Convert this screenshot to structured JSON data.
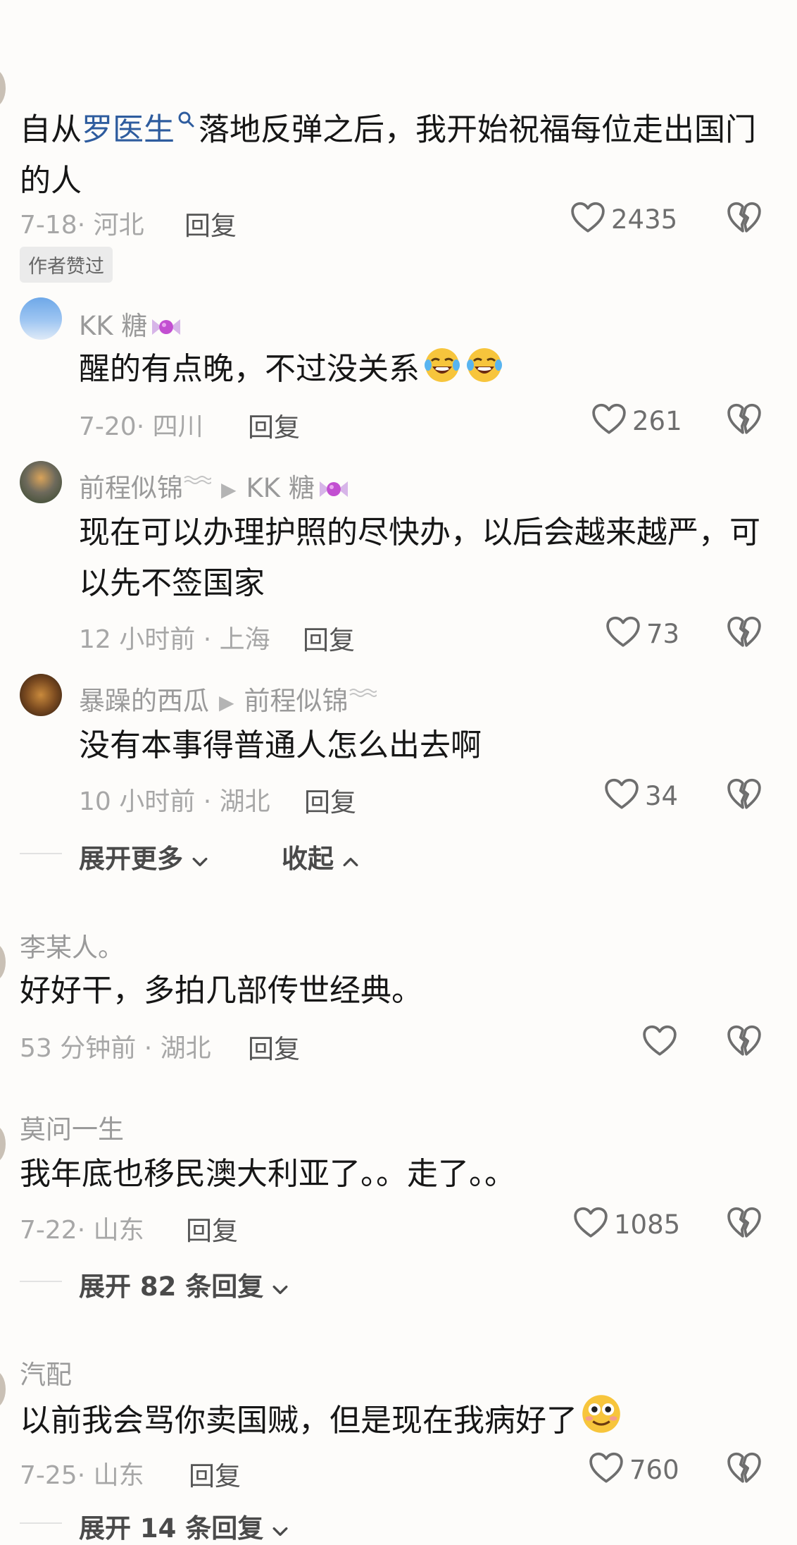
{
  "comments": [
    {
      "username": "",
      "text_before_link": "自从",
      "link_text": "罗医生",
      "text_after_link": "落地反弹之后，我开始祝福每位走出国门的人",
      "date": "7-18",
      "location": "河北",
      "reply_label": "回复",
      "likes": "2435",
      "badge": "作者赞过",
      "replies": [
        {
          "username": "KK 糖",
          "text": "醒的有点晚，不过没关系",
          "date": "7-20",
          "location": "四川",
          "reply_label": "回复",
          "likes": "261"
        },
        {
          "username": "前程似锦",
          "reply_to": "KK 糖",
          "text": "现在可以办理护照的尽快办，以后会越来越严，可以先不签国家",
          "date": "12 小时前",
          "location": "上海",
          "reply_label": "回复",
          "likes": "73"
        },
        {
          "username": "暴躁的西瓜",
          "reply_to": "前程似锦",
          "text": "没有本事得普通人怎么出去啊",
          "date": "10 小时前",
          "location": "湖北",
          "reply_label": "回复",
          "likes": "34"
        }
      ],
      "expand_more": "展开更多",
      "collapse": "收起"
    },
    {
      "username": "李某人。",
      "text": "好好干，多拍几部传世经典。",
      "date": "53 分钟前",
      "location": "湖北",
      "reply_label": "回复",
      "likes": ""
    },
    {
      "username": "莫问一生",
      "text": "我年底也移民澳大利亚了。。走了。。",
      "date": "7-22",
      "location": "山东",
      "reply_label": "回复",
      "likes": "1085",
      "expand_replies": "展开 82 条回复"
    },
    {
      "username": "汽配",
      "text": "以前我会骂你卖国贼，但是现在我病好了",
      "date": "7-25",
      "location": "山东",
      "reply_label": "回复",
      "likes": "760",
      "expand_replies": "展开 14 条回复"
    }
  ]
}
